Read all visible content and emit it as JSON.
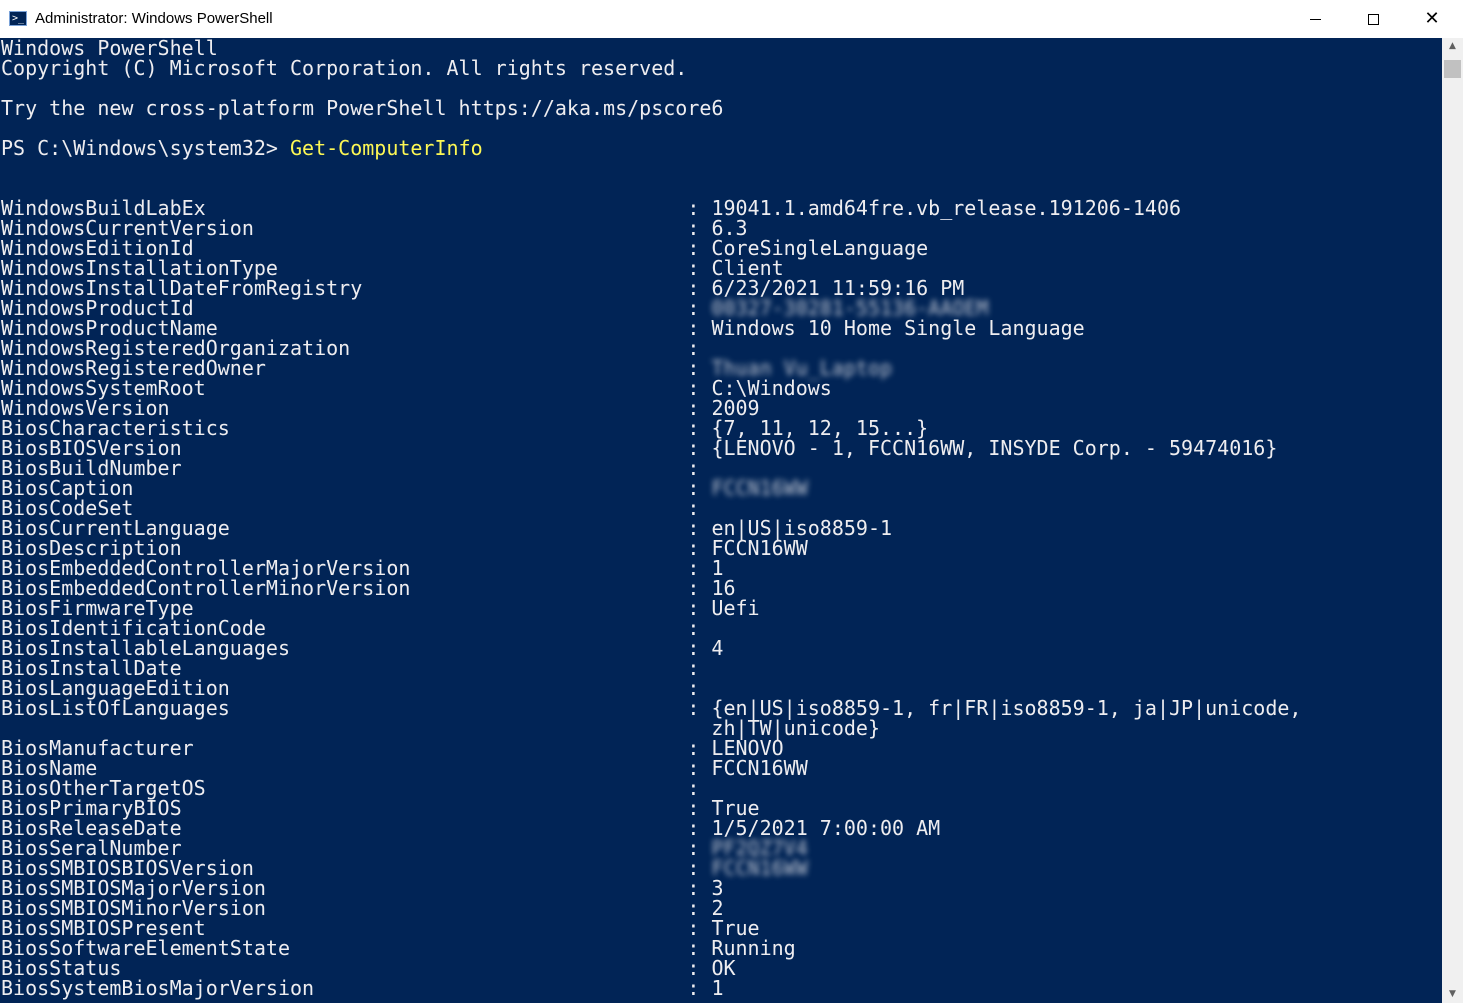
{
  "window": {
    "title": "Administrator: Windows PowerShell",
    "icon": "powershell-icon",
    "controls": {
      "minimize": "minimize-icon",
      "maximize": "maximize-icon",
      "close": "close-icon"
    }
  },
  "colors": {
    "console_bg": "#012456",
    "console_fg": "#eeedf0",
    "command": "#fcf754",
    "titlebar": "#ffffff"
  },
  "console": {
    "banner": [
      "Windows PowerShell",
      "Copyright (C) Microsoft Corporation. All rights reserved.",
      "",
      "Try the new cross-platform PowerShell https://aka.ms/pscore6",
      ""
    ],
    "prompt": "PS C:\\Windows\\system32> ",
    "command": "Get-ComputerInfo",
    "separator": " : ",
    "properties": [
      {
        "name": "WindowsBuildLabEx",
        "value": "19041.1.amd64fre.vb_release.191206-1406"
      },
      {
        "name": "WindowsCurrentVersion",
        "value": "6.3"
      },
      {
        "name": "WindowsEditionId",
        "value": "CoreSingleLanguage"
      },
      {
        "name": "WindowsInstallationType",
        "value": "Client"
      },
      {
        "name": "WindowsInstallDateFromRegistry",
        "value": "6/23/2021 11:59:16 PM"
      },
      {
        "name": "WindowsProductId",
        "value": "00327-30281-55136-AAOEM",
        "blurred": true
      },
      {
        "name": "WindowsProductName",
        "value": "Windows 10 Home Single Language"
      },
      {
        "name": "WindowsRegisteredOrganization",
        "value": ""
      },
      {
        "name": "WindowsRegisteredOwner",
        "value": "Thuan Vu_Laptop",
        "blurred": true
      },
      {
        "name": "WindowsSystemRoot",
        "value": "C:\\Windows"
      },
      {
        "name": "WindowsVersion",
        "value": "2009"
      },
      {
        "name": "BiosCharacteristics",
        "value": "{7, 11, 12, 15...}"
      },
      {
        "name": "BiosBIOSVersion",
        "value": "{LENOVO - 1, FCCN16WW, INSYDE Corp. - 59474016}"
      },
      {
        "name": "BiosBuildNumber",
        "value": ""
      },
      {
        "name": "BiosCaption",
        "value": "FCCN16WW",
        "blurred": true
      },
      {
        "name": "BiosCodeSet",
        "value": ""
      },
      {
        "name": "BiosCurrentLanguage",
        "value": "en|US|iso8859-1"
      },
      {
        "name": "BiosDescription",
        "value": "FCCN16WW"
      },
      {
        "name": "BiosEmbeddedControllerMajorVersion",
        "value": "1"
      },
      {
        "name": "BiosEmbeddedControllerMinorVersion",
        "value": "16"
      },
      {
        "name": "BiosFirmwareType",
        "value": "Uefi"
      },
      {
        "name": "BiosIdentificationCode",
        "value": ""
      },
      {
        "name": "BiosInstallableLanguages",
        "value": "4"
      },
      {
        "name": "BiosInstallDate",
        "value": ""
      },
      {
        "name": "BiosLanguageEdition",
        "value": ""
      },
      {
        "name": "BiosListOfLanguages",
        "value": "{en|US|iso8859-1, fr|FR|iso8859-1, ja|JP|unicode,",
        "continuation": "zh|TW|unicode}"
      },
      {
        "name": "BiosManufacturer",
        "value": "LENOVO"
      },
      {
        "name": "BiosName",
        "value": "FCCN16WW"
      },
      {
        "name": "BiosOtherTargetOS",
        "value": ""
      },
      {
        "name": "BiosPrimaryBIOS",
        "value": "True"
      },
      {
        "name": "BiosReleaseDate",
        "value": "1/5/2021 7:00:00 AM"
      },
      {
        "name": "BiosSeralNumber",
        "value": "PF2QZ7V4",
        "blurred": true
      },
      {
        "name": "BiosSMBIOSBIOSVersion",
        "value": "FCCN16WW",
        "blurred": true
      },
      {
        "name": "BiosSMBIOSMajorVersion",
        "value": "3"
      },
      {
        "name": "BiosSMBIOSMinorVersion",
        "value": "2"
      },
      {
        "name": "BiosSMBIOSPresent",
        "value": "True"
      },
      {
        "name": "BiosSoftwareElementState",
        "value": "Running"
      },
      {
        "name": "BiosStatus",
        "value": "OK"
      },
      {
        "name": "BiosSystemBiosMajorVersion",
        "value": "1"
      }
    ]
  },
  "scrollbar": {
    "up": "scroll-up-icon",
    "down": "scroll-down-icon"
  }
}
